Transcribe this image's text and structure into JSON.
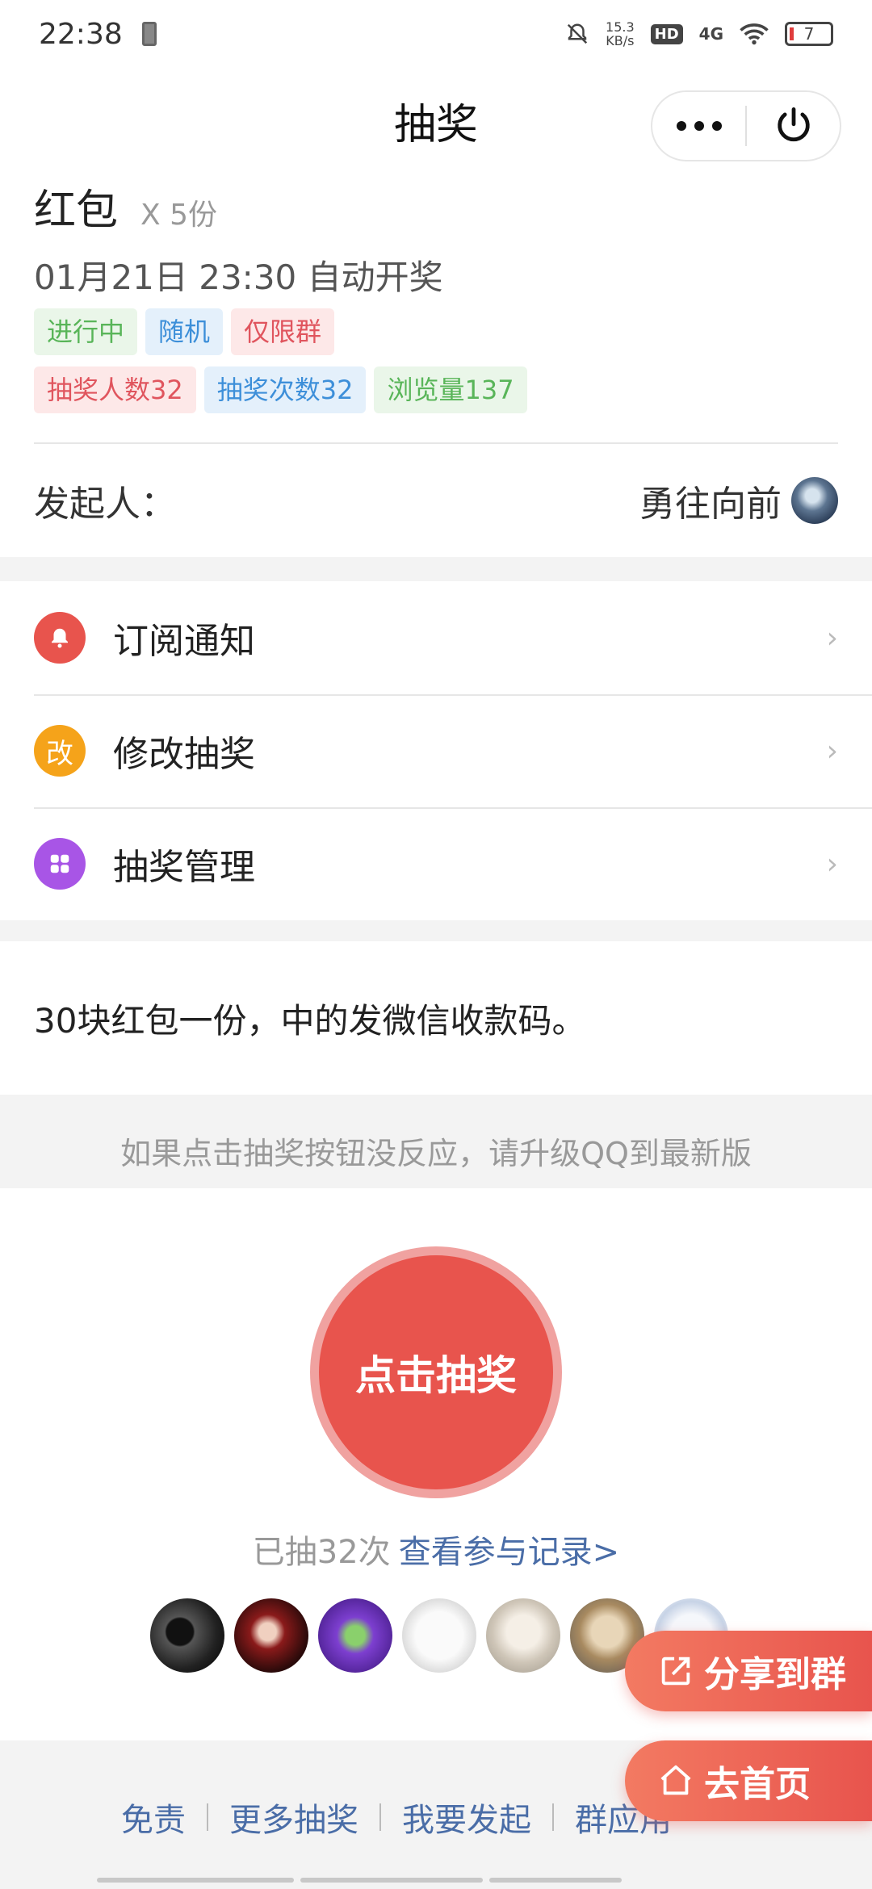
{
  "status_bar": {
    "time": "22:38",
    "speed_value": "15.3",
    "speed_unit": "KB/s",
    "hd": "HD",
    "network": "4G",
    "battery": "7"
  },
  "header": {
    "title": "抽奖"
  },
  "prize": {
    "name": "红包",
    "count": "X 5份",
    "open_time": "01月21日 23:30 自动开奖",
    "tags_row1": [
      "进行中",
      "随机",
      "仅限群"
    ],
    "tags_row2": [
      "抽奖人数32",
      "抽奖次数32",
      "浏览量137"
    ]
  },
  "initiator": {
    "label": "发起人：",
    "name": "勇往向前"
  },
  "menu": {
    "items": [
      {
        "label": "订阅通知",
        "color": "#e8544d",
        "icon": "bell-icon"
      },
      {
        "label": "修改抽奖",
        "color": "#f5a31a",
        "icon": "edit-icon",
        "glyph": "改"
      },
      {
        "label": "抽奖管理",
        "color": "#a855e6",
        "icon": "grid-icon"
      }
    ]
  },
  "description": "30块红包一份，中的发微信收款码。",
  "notice": "如果点击抽奖按钮没反应，请升级QQ到最新版",
  "draw": {
    "button_label": "点击抽奖",
    "count_text": "已抽32次",
    "records_link": "查看参与记录>"
  },
  "float_buttons": {
    "share": "分享到群",
    "home": "去首页"
  },
  "footer": {
    "links": [
      "免责",
      "更多抽奖",
      "我要发起",
      "群应用"
    ]
  },
  "colors": {
    "accent": "#e8544d",
    "link": "#4a6da7"
  }
}
